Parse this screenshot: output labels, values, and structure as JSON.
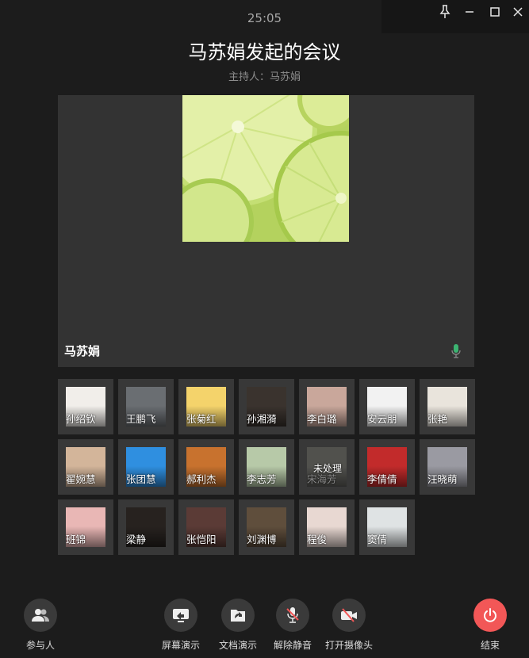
{
  "window": {
    "pin_icon": "pin-icon",
    "minimize_icon": "minimize-icon",
    "maximize_icon": "maximize-icon",
    "close_icon": "close-icon"
  },
  "meeting": {
    "timer": "25:05",
    "title": "马苏娟发起的会议",
    "host_label": "主持人：马苏娟"
  },
  "main_video": {
    "speaker_name": "马苏娟",
    "mic_icon": "microphone-icon",
    "mic_color": "#3cb371"
  },
  "participants": [
    {
      "name": "孙绍钦",
      "avatar_color": "#f1eeea"
    },
    {
      "name": "王鹏飞",
      "avatar_color": "#6a6e72"
    },
    {
      "name": "张菊红",
      "avatar_color": "#f4d36b"
    },
    {
      "name": "孙湘漪",
      "avatar_color": "#3a332e"
    },
    {
      "name": "李白璐",
      "avatar_color": "#c9a79b"
    },
    {
      "name": "安云朋",
      "avatar_color": "#f2f2f2"
    },
    {
      "name": "张艳",
      "avatar_color": "#e9e4dc"
    },
    {
      "name": "翟婉慧",
      "avatar_color": "#d3b59a"
    },
    {
      "name": "张团慧",
      "avatar_color": "#2f8fe0"
    },
    {
      "name": "郝利杰",
      "avatar_color": "#c8722e"
    },
    {
      "name": "李志芳",
      "avatar_color": "#b7c9a8"
    },
    {
      "name": "宋海芳",
      "avatar_color": "#5a5a55",
      "status": "未处理",
      "dimmed": true
    },
    {
      "name": "李倩倩",
      "avatar_color": "#c22b2b"
    },
    {
      "name": "汪晓萌",
      "avatar_color": "#9a9aa2"
    },
    {
      "name": "班锦",
      "avatar_color": "#e9b7b5"
    },
    {
      "name": "梁静",
      "avatar_color": "#27221f"
    },
    {
      "name": "张恺阳",
      "avatar_color": "#5b3b36"
    },
    {
      "name": "刘渊博",
      "avatar_color": "#5f4e3c"
    },
    {
      "name": "程俊",
      "avatar_color": "#e8d8d2"
    },
    {
      "name": "窦倩",
      "avatar_color": "#dfe3e4"
    }
  ],
  "controls": {
    "participants": {
      "label": "参与人",
      "icon": "participants-icon"
    },
    "screen_share": {
      "label": "屏幕演示",
      "icon": "screen-share-icon"
    },
    "doc_share": {
      "label": "文档演示",
      "icon": "document-share-icon"
    },
    "unmute": {
      "label": "解除静音",
      "icon": "microphone-muted-icon"
    },
    "camera": {
      "label": "打开摄像头",
      "icon": "camera-off-icon"
    },
    "end": {
      "label": "结束",
      "icon": "power-icon",
      "color": "#f25757"
    }
  }
}
